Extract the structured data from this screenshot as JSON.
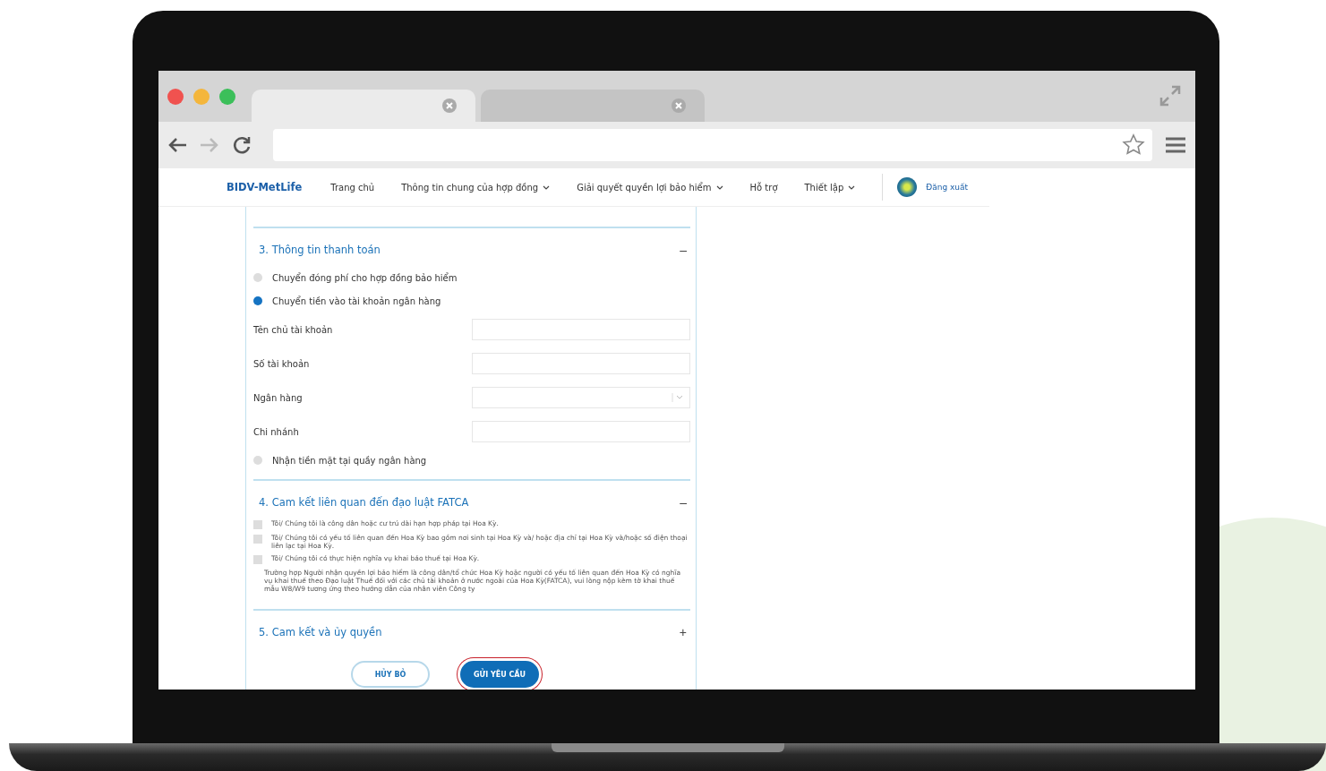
{
  "browser": {
    "tabs": [
      {
        "selected": true
      },
      {
        "selected": false
      }
    ]
  },
  "nav": {
    "logo": "BIDV-MetLife",
    "items": [
      {
        "label": "Trang chủ",
        "dropdown": false
      },
      {
        "label": "Thông tin chung của hợp đồng",
        "dropdown": true
      },
      {
        "label": "Giải quyết quyền lợi bảo hiểm",
        "dropdown": true
      },
      {
        "label": "Hỗ trợ",
        "dropdown": false
      },
      {
        "label": "Thiết lập",
        "dropdown": true
      }
    ],
    "logout": "Đăng xuất"
  },
  "payment": {
    "title": "3. Thông tin thanh toán",
    "toggle": "–",
    "options": [
      {
        "label": "Chuyển đóng phí cho hợp đồng bảo hiểm",
        "selected": false
      },
      {
        "label": "Chuyển tiền vào tài khoản ngân hàng",
        "selected": true,
        "fields": [
          {
            "label": "Tên chủ tài khoản",
            "kind": "text"
          },
          {
            "label": "Số tài khoản",
            "kind": "text"
          },
          {
            "label": "Ngân hàng",
            "kind": "select"
          },
          {
            "label": "Chi nhánh",
            "kind": "text"
          }
        ]
      },
      {
        "label": "Nhận tiền mặt tại quầy ngân hàng",
        "selected": false
      }
    ]
  },
  "fatca": {
    "title": "4. Cam kết liên quan đến đạo luật FATCA",
    "toggle": "–",
    "checks": [
      {
        "label": "Tôi/ Chúng tôi là công dân hoặc cư trú dài hạn hợp pháp tại Hoa Kỳ.",
        "checked": false
      },
      {
        "label": "Tôi/ Chúng tôi có yếu tố liên quan đến Hoa Kỳ bao gồm nơi sinh tại Hoa Kỳ và/ hoặc địa chỉ tại Hoa Kỳ và/hoặc số điện thoại liên lạc tại Hoa Kỳ.",
        "checked": false
      },
      {
        "label": "Tôi/ Chúng tôi có thực hiện nghĩa vụ khai báo thuế tại Hoa Kỳ.",
        "checked": false
      }
    ],
    "note": "Trường hợp Người nhận quyền lợi bảo hiểm là công dân/tổ chức Hoa Kỳ hoặc người có yếu tố liên quan đến Hoa Kỳ có nghĩa vụ khai thuế theo Đạo luật Thuế đối với các chủ tài khoản ở nước ngoài của Hoa Kỳ(FATCA), vui lòng nộp kèm tờ khai thuế mẫu W8/W9 tương ứng theo hướng dẫn của nhân viên Công ty"
  },
  "authorization": {
    "title": "5. Cam kết và ủy quyền",
    "toggle": "+"
  },
  "buttons": [
    {
      "label": "HỦY BỎ",
      "kind": "secondary",
      "highlighted": false
    },
    {
      "label": "GỬI YÊU CẦU",
      "kind": "primary",
      "highlighted": true
    }
  ]
}
